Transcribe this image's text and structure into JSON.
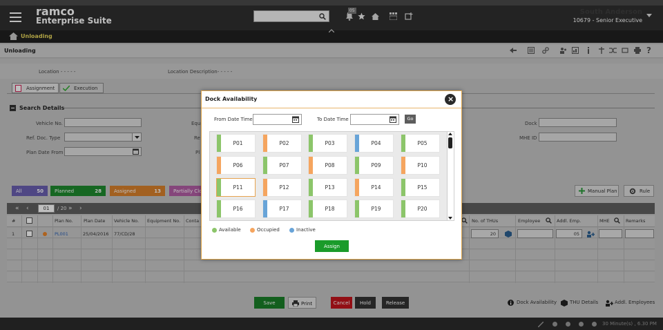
{
  "header": {
    "brand_line1": "ramco",
    "brand_line2": "Enterprise Suite",
    "notification_count": "05",
    "user_name": "South Anderson",
    "user_role": "10679 - Senior Executive"
  },
  "nav": {
    "breadcrumb": "Unloading"
  },
  "page": {
    "title": "Unloading"
  },
  "form": {
    "location_label": "Location - - - - -",
    "location_desc_label": "Location Description- - - - -",
    "tabs": [
      "Assignment",
      "Execution"
    ],
    "search_details": "Search Details",
    "vehicle_no_label": "Vehicle No.",
    "ref_doc_type_label": "Ref. Doc. Type",
    "plan_date_from_label": "Plan Date From",
    "equip_label": "Equ",
    "re_label": "Re",
    "pl_label": "Pl",
    "dock_label": "Dock",
    "mhe_id_label": "MHE ID",
    "status_buttons": [
      {
        "label": "All",
        "count": "50"
      },
      {
        "label": "Planned",
        "count": "28"
      },
      {
        "label": "Assigned",
        "count": "13"
      },
      {
        "label": "Partially Clo",
        "count": ""
      }
    ],
    "manual_plan": "Manual Plan",
    "rule": "Rule"
  },
  "grid": {
    "page_current": "01",
    "page_total": "/ 20",
    "columns": [
      "#",
      "Plan No.",
      "Plan Date",
      "Vehicle No.",
      "Equipment No.",
      "Conta",
      "No. of THUs",
      "Employee",
      "Addl. Emp.",
      "MHE",
      "Remarks"
    ],
    "row": {
      "index": "1",
      "plan_no": "PL001",
      "plan_date": "25/04/2016",
      "vehicle_no": "77/CD/28",
      "thus": "20",
      "addl_emp": "05"
    }
  },
  "bottom": {
    "save": "Save",
    "print": "Print",
    "cancel": "Cancel",
    "hold": "Hold",
    "release": "Release",
    "dock_availability": "Dock Availability",
    "thu_details": "THU Details",
    "addl_employees": "Addl. Employees",
    "footer_time": "30 Minute(s) , 6.30 PM"
  },
  "modal": {
    "title": "Dock Availability",
    "from_label": "From Date Time",
    "to_label": "To Date Time",
    "go": "Go",
    "docks": [
      {
        "name": "P01",
        "status": "available"
      },
      {
        "name": "P02",
        "status": "occupied"
      },
      {
        "name": "P03",
        "status": "available"
      },
      {
        "name": "P04",
        "status": "inactive"
      },
      {
        "name": "P05",
        "status": "available"
      },
      {
        "name": "P06",
        "status": "occupied"
      },
      {
        "name": "P07",
        "status": "available"
      },
      {
        "name": "P08",
        "status": "occupied"
      },
      {
        "name": "P09",
        "status": "available"
      },
      {
        "name": "P10",
        "status": "occupied"
      },
      {
        "name": "P11",
        "status": "available"
      },
      {
        "name": "P12",
        "status": "occupied"
      },
      {
        "name": "P13",
        "status": "available"
      },
      {
        "name": "P14",
        "status": "occupied"
      },
      {
        "name": "P15",
        "status": "available"
      },
      {
        "name": "P16",
        "status": "available"
      },
      {
        "name": "P17",
        "status": "inactive"
      },
      {
        "name": "P18",
        "status": "available"
      },
      {
        "name": "P19",
        "status": "available"
      },
      {
        "name": "P20",
        "status": "available"
      }
    ],
    "selected_dock": "P11",
    "legend": [
      "Available",
      "Occupied",
      "Inactive"
    ],
    "assign": "Assign"
  },
  "colors": {
    "available": "#8cc56a",
    "occupied": "#f5a55f",
    "inactive": "#68a4d8",
    "accent": "#e8b46b",
    "assign_green": "#1a9b2a"
  }
}
